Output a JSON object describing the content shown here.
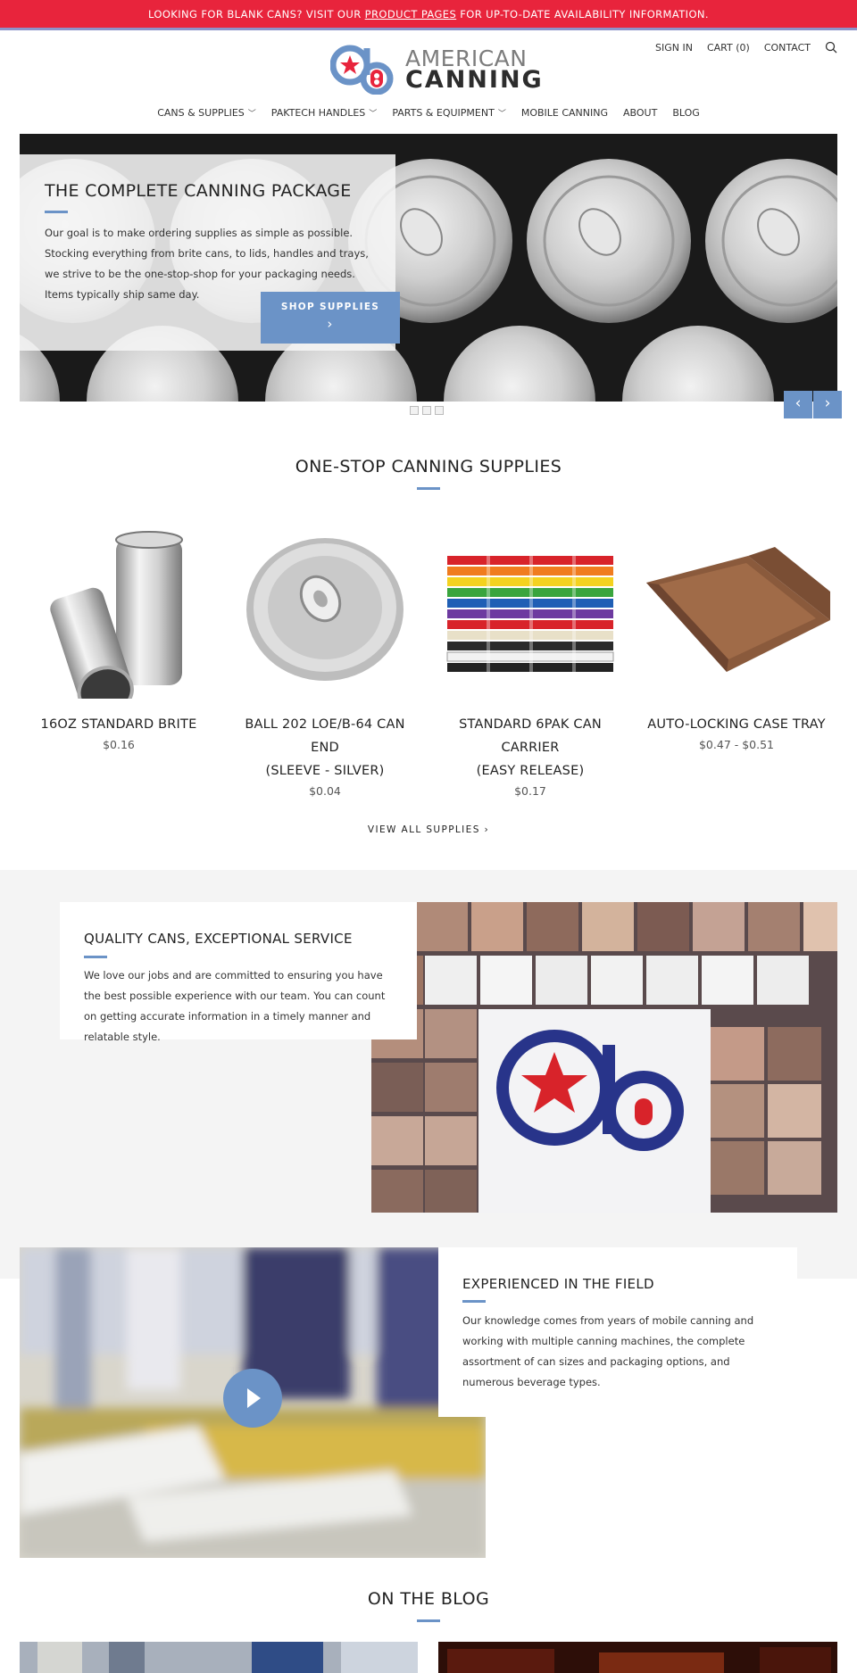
{
  "banner": {
    "text_before": "LOOKING FOR BLANK CANS? VISIT OUR",
    "link": "PRODUCT PAGES",
    "text_after": "FOR UP-TO-DATE AVAILABILITY INFORMATION."
  },
  "logo": {
    "word1": "AMERICAN",
    "word2": "CANNING"
  },
  "header": {
    "sign_in": "SIGN IN",
    "cart": "CART (0)",
    "contact": "CONTACT"
  },
  "nav": {
    "items": [
      {
        "label": "CANS & SUPPLIES",
        "dropdown": true
      },
      {
        "label": "PAKTECH HANDLES",
        "dropdown": true
      },
      {
        "label": "PARTS & EQUIPMENT",
        "dropdown": true
      },
      {
        "label": "MOBILE CANNING",
        "dropdown": false
      },
      {
        "label": "ABOUT",
        "dropdown": false
      },
      {
        "label": "BLOG",
        "dropdown": false
      }
    ]
  },
  "hero": {
    "title": "THE COMPLETE CANNING PACKAGE",
    "text": "Our goal is to make ordering supplies as simple as possible. Stocking everything from brite cans, to lids, handles and trays, we strive to be the one-stop-shop for your packaging needs. Items typically ship same day.",
    "button": "SHOP SUPPLIES",
    "prev": "‹",
    "next": "›",
    "button_arrow": "›"
  },
  "supplies": {
    "title": "ONE-STOP CANNING SUPPLIES",
    "view_all": "VIEW ALL SUPPLIES",
    "view_all_arrow": "›",
    "products": [
      {
        "name_line1": "16OZ STANDARD BRITE",
        "name_line2": "",
        "name_line3": "",
        "price": "$0.16"
      },
      {
        "name_line1": "BALL 202 LOE/B-64 CAN END",
        "name_line2": "(SLEEVE - SILVER)",
        "name_line3": "",
        "price": "$0.04"
      },
      {
        "name_line1": "STANDARD 6PAK CAN",
        "name_line2": "CARRIER",
        "name_line3": "(EASY RELEASE)",
        "price": "$0.17"
      },
      {
        "name_line1": "AUTO-LOCKING CASE TRAY",
        "name_line2": "",
        "name_line3": "",
        "price": "$0.47 - $0.51"
      }
    ]
  },
  "quality": {
    "title": "QUALITY CANS, EXCEPTIONAL SERVICE",
    "text": "We love our jobs and are committed to ensuring you have the best possible experience with our team. You can count on getting accurate information in a timely manner and relatable style."
  },
  "experience": {
    "title": "EXPERIENCED IN THE FIELD",
    "text": "Our knowledge comes from years of mobile canning and working with multiple canning machines, the complete assortment of can sizes and packaging options, and numerous beverage types."
  },
  "blog": {
    "title": "ON THE BLOG"
  },
  "colors": {
    "banner": "#e8243c",
    "accent": "#6b93c7",
    "band": "#f4f4f4"
  },
  "icons": {
    "search": "search-icon",
    "play": "play-icon",
    "chevron": "chevron-down-icon"
  }
}
